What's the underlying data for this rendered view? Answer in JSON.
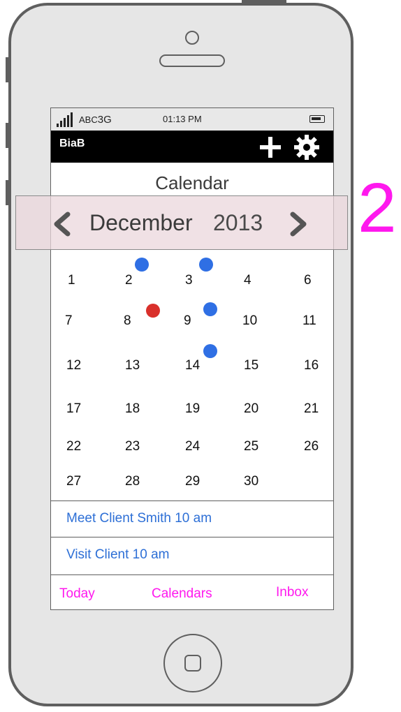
{
  "status_bar": {
    "carrier": "ABC",
    "network": "3G",
    "time": "01:13 PM"
  },
  "app_bar": {
    "title": "BiaB",
    "add_icon": "plus-icon",
    "settings_icon": "gear-icon"
  },
  "calendar": {
    "title": "Calendar",
    "month": "December",
    "year": "2013",
    "days": [
      [
        "1",
        "2",
        "3",
        "4",
        "6"
      ],
      [
        "7",
        "8",
        "9",
        "10",
        "11"
      ],
      [
        "12",
        "13",
        "14",
        "15",
        "16"
      ],
      [
        "17",
        "18",
        "19",
        "20",
        "21"
      ],
      [
        "22",
        "23",
        "24",
        "25",
        "26"
      ],
      [
        "27",
        "28",
        "29",
        "30"
      ]
    ],
    "event_dot_colors": {
      "blue": "#2f6fe4",
      "red": "#d9302b"
    }
  },
  "events": [
    {
      "label": "Meet Client Smith 10 am"
    },
    {
      "label": "Visit Client 10 am"
    }
  ],
  "tabs": {
    "today": "Today",
    "calendars": "Calendars",
    "inbox": "Inbox"
  },
  "annotation": "2"
}
